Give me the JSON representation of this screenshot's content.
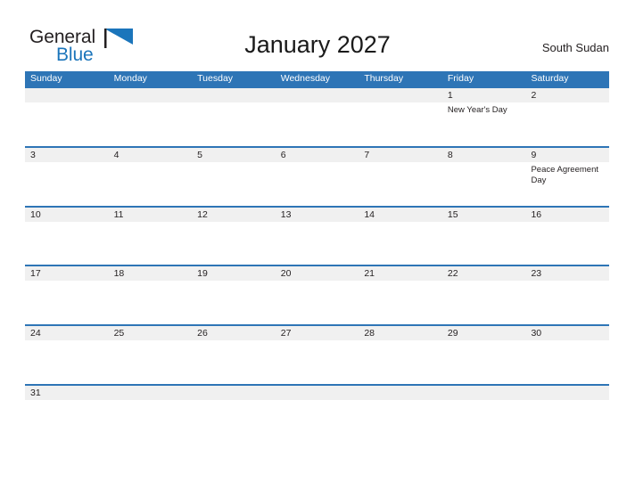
{
  "brand": {
    "line1": "General",
    "line2": "Blue",
    "mark": "blue-flag-triangle"
  },
  "header": {
    "title": "January 2027",
    "country": "South Sudan"
  },
  "colors": {
    "header_blue": "#2e75b6",
    "row_divider_blue": "#2e75b6",
    "date_band_gray": "#f0f0f0",
    "brand_blue": "#1b75bb",
    "text_dark": "#231f20"
  },
  "calendar": {
    "weekdays": [
      "Sunday",
      "Monday",
      "Tuesday",
      "Wednesday",
      "Thursday",
      "Friday",
      "Saturday"
    ],
    "weeks": [
      {
        "days": [
          {
            "date": "",
            "event": ""
          },
          {
            "date": "",
            "event": ""
          },
          {
            "date": "",
            "event": ""
          },
          {
            "date": "",
            "event": ""
          },
          {
            "date": "",
            "event": ""
          },
          {
            "date": "1",
            "event": "New Year's Day"
          },
          {
            "date": "2",
            "event": ""
          }
        ]
      },
      {
        "days": [
          {
            "date": "3",
            "event": ""
          },
          {
            "date": "4",
            "event": ""
          },
          {
            "date": "5",
            "event": ""
          },
          {
            "date": "6",
            "event": ""
          },
          {
            "date": "7",
            "event": ""
          },
          {
            "date": "8",
            "event": ""
          },
          {
            "date": "9",
            "event": "Peace Agreement Day"
          }
        ]
      },
      {
        "days": [
          {
            "date": "10",
            "event": ""
          },
          {
            "date": "11",
            "event": ""
          },
          {
            "date": "12",
            "event": ""
          },
          {
            "date": "13",
            "event": ""
          },
          {
            "date": "14",
            "event": ""
          },
          {
            "date": "15",
            "event": ""
          },
          {
            "date": "16",
            "event": ""
          }
        ]
      },
      {
        "days": [
          {
            "date": "17",
            "event": ""
          },
          {
            "date": "18",
            "event": ""
          },
          {
            "date": "19",
            "event": ""
          },
          {
            "date": "20",
            "event": ""
          },
          {
            "date": "21",
            "event": ""
          },
          {
            "date": "22",
            "event": ""
          },
          {
            "date": "23",
            "event": ""
          }
        ]
      },
      {
        "days": [
          {
            "date": "24",
            "event": ""
          },
          {
            "date": "25",
            "event": ""
          },
          {
            "date": "26",
            "event": ""
          },
          {
            "date": "27",
            "event": ""
          },
          {
            "date": "28",
            "event": ""
          },
          {
            "date": "29",
            "event": ""
          },
          {
            "date": "30",
            "event": ""
          }
        ]
      },
      {
        "days": [
          {
            "date": "31",
            "event": ""
          },
          {
            "date": "",
            "event": ""
          },
          {
            "date": "",
            "event": ""
          },
          {
            "date": "",
            "event": ""
          },
          {
            "date": "",
            "event": ""
          },
          {
            "date": "",
            "event": ""
          },
          {
            "date": "",
            "event": ""
          }
        ]
      }
    ]
  }
}
